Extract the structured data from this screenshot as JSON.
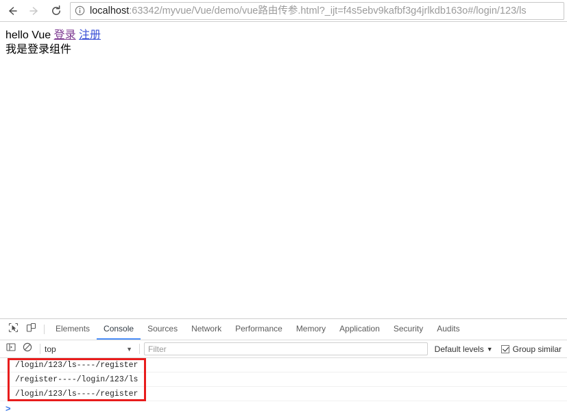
{
  "browser": {
    "back_icon": "arrow-left-icon",
    "forward_icon": "arrow-right-icon",
    "reload_icon": "reload-icon",
    "info_icon": "info-circle-icon",
    "url_host": "localhost",
    "url_rest": ":63342/myvue/Vue/demo/vue路由传参.html?_ijt=f4s5ebv9kafbf3g4jrlkdb163o#/login/123/ls",
    "url_full": "localhost:63342/myvue/Vue/demo/vue路由传参.html?_ijt=f4s5ebv9kafbf3g4jrlkdb163o#/login/123/ls"
  },
  "page": {
    "heading_text": "hello Vue ",
    "link_login": "登录",
    "link_register": "注册",
    "body_text": "我是登录组件"
  },
  "devtools": {
    "inspect_icon": "inspect-element-icon",
    "device_icon": "device-toolbar-icon",
    "tabs": [
      {
        "label": "Elements",
        "active": false
      },
      {
        "label": "Console",
        "active": true
      },
      {
        "label": "Sources",
        "active": false
      },
      {
        "label": "Network",
        "active": false
      },
      {
        "label": "Performance",
        "active": false
      },
      {
        "label": "Memory",
        "active": false
      },
      {
        "label": "Application",
        "active": false
      },
      {
        "label": "Security",
        "active": false
      },
      {
        "label": "Audits",
        "active": false
      }
    ],
    "filterbar": {
      "sidebar_icon": "console-sidebar-icon",
      "clear_icon": "clear-console-icon",
      "context": "top",
      "context_caret": "▼",
      "filter_placeholder": "Filter",
      "filter_value": "",
      "levels_label": "Default levels",
      "levels_caret": "▼",
      "group_similar_label": "Group similar",
      "group_similar_checked": true
    },
    "console": {
      "messages": [
        "/login/123/ls----/register",
        "/register----/login/123/ls",
        "/login/123/ls----/register"
      ],
      "prompt": ">",
      "annotation_color": "#e81c1c"
    }
  }
}
